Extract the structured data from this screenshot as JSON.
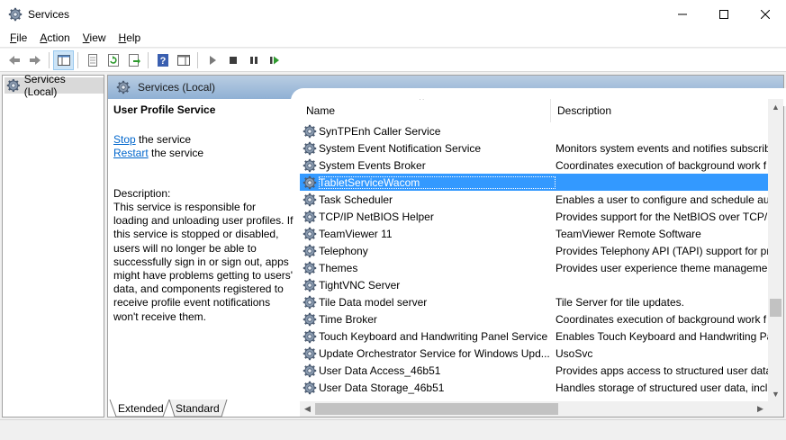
{
  "window": {
    "title": "Services"
  },
  "menu": [
    {
      "label": "File",
      "key": "F",
      "rest": "ile"
    },
    {
      "label": "Action",
      "key": "A",
      "rest": "ction"
    },
    {
      "label": "View",
      "key": "V",
      "rest": "iew"
    },
    {
      "label": "Help",
      "key": "H",
      "rest": "elp"
    }
  ],
  "toolbar": {
    "icons": [
      "back-arrow-icon",
      "forward-arrow-icon",
      "show-hide-console-tree-icon",
      "properties-icon",
      "refresh-icon",
      "export-list-icon",
      "help-icon",
      "show-hide-action-pane-icon",
      "start-service-icon",
      "stop-service-icon",
      "pause-service-icon",
      "resume-service-icon"
    ]
  },
  "tree": {
    "root_label": "Services (Local)"
  },
  "main": {
    "header_label": "Services (Local)",
    "service_title": "User Profile Service",
    "stop_link": "Stop",
    "stop_rest": " the service",
    "restart_link": "Restart",
    "restart_rest": " the service",
    "description_label": "Description:",
    "description_text": "This service is responsible for loading and unloading user profiles. If this service is stopped or disabled, users will no longer be able to successfully sign in or sign out, apps might have problems getting to users' data, and components registered to receive profile event notifications won't receive them."
  },
  "list": {
    "columns": {
      "name": "Name",
      "description": "Description"
    },
    "sort_indicator": "^",
    "rows": [
      {
        "name": "SynTPEnh Caller Service",
        "description": ""
      },
      {
        "name": "System Event Notification Service",
        "description": "Monitors system events and notifies subscrib"
      },
      {
        "name": "System Events Broker",
        "description": "Coordinates execution of background work f"
      },
      {
        "name": "TabletServiceWacom",
        "description": ""
      },
      {
        "name": "Task Scheduler",
        "description": "Enables a user to configure and schedule aut"
      },
      {
        "name": "TCP/IP NetBIOS Helper",
        "description": "Provides support for the NetBIOS over TCP/IP"
      },
      {
        "name": "TeamViewer 11",
        "description": "TeamViewer Remote Software"
      },
      {
        "name": "Telephony",
        "description": "Provides Telephony API (TAPI) support for pr"
      },
      {
        "name": "Themes",
        "description": "Provides user experience theme managemen"
      },
      {
        "name": "TightVNC Server",
        "description": ""
      },
      {
        "name": "Tile Data model server",
        "description": "Tile Server for tile updates."
      },
      {
        "name": "Time Broker",
        "description": "Coordinates execution of background work f"
      },
      {
        "name": "Touch Keyboard and Handwriting Panel Service",
        "description": "Enables Touch Keyboard and Handwriting Pa"
      },
      {
        "name": "Update Orchestrator Service for Windows Upd...",
        "description": "UsoSvc"
      },
      {
        "name": "User Data Access_46b51",
        "description": "Provides apps access to structured user data,"
      },
      {
        "name": "User Data Storage_46b51",
        "description": "Handles storage of structured user data, incl"
      }
    ],
    "selected_index": 3
  },
  "tabs": [
    {
      "label": "Extended"
    },
    {
      "label": "Standard"
    }
  ],
  "colors": {
    "selection": "#3399ff",
    "link": "#0066cc",
    "header_band": "#a9c2de"
  }
}
